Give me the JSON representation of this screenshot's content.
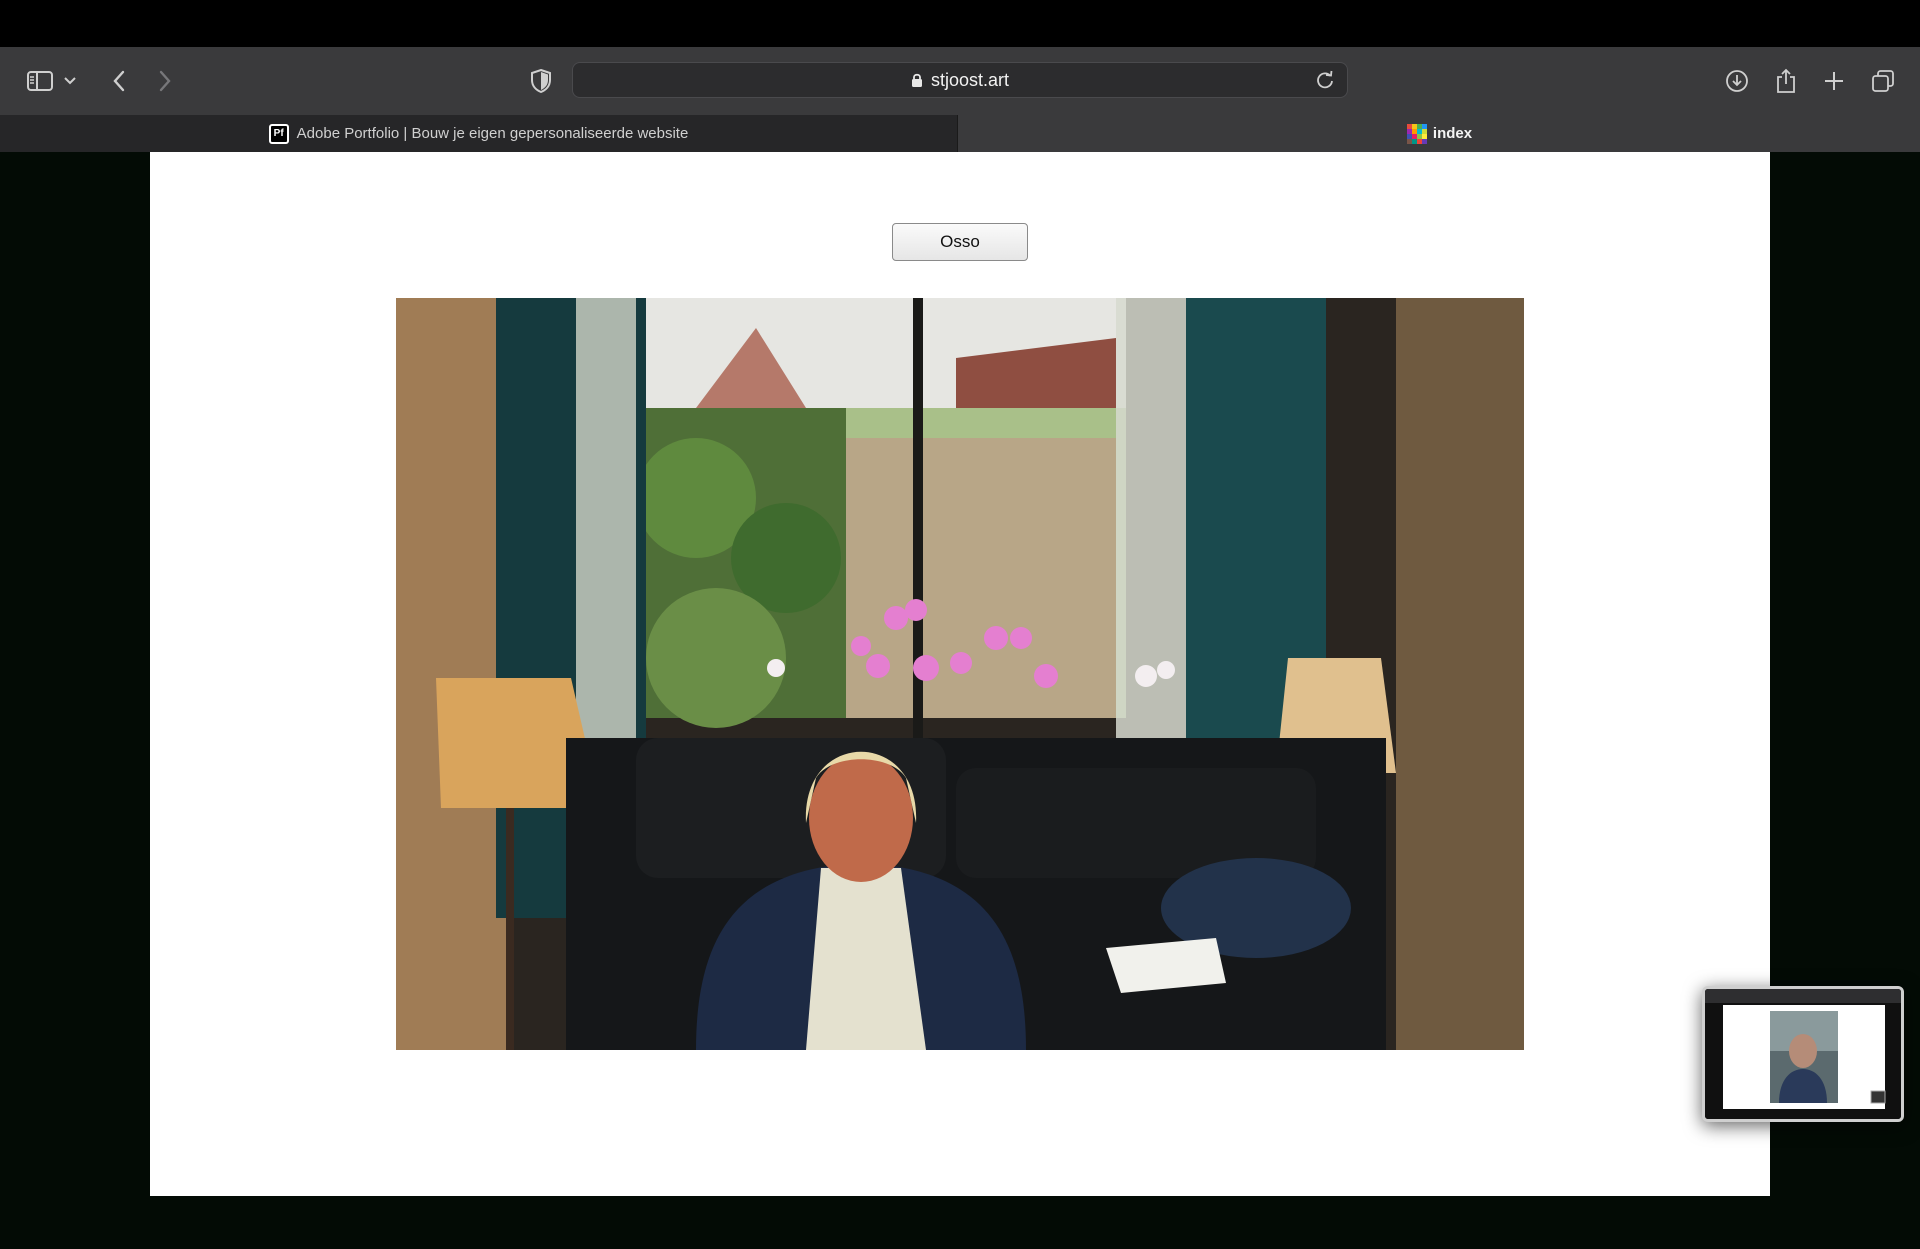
{
  "browser": {
    "url": "stjoost.art",
    "tabs": [
      {
        "label": "Adobe Portfolio | Bouw je eigen gepersonaliseerde website",
        "icon_text": "Pf",
        "active": false
      },
      {
        "label": "index",
        "active": true
      }
    ]
  },
  "page": {
    "button_label": "Osso",
    "photo": {
      "subject": "photo-woman-seated-living-room"
    }
  },
  "pip": {
    "thumbnail": "photo-man-outdoors"
  },
  "colors": {
    "menubar": "#000000",
    "toolbar": "#3a3a3c",
    "inactive_tab": "#262628",
    "background": "#030b05",
    "page": "#ffffff"
  }
}
